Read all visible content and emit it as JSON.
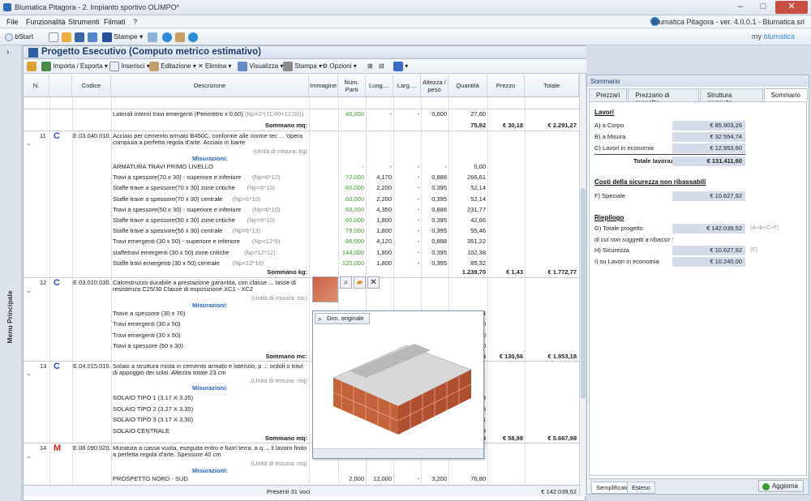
{
  "window": {
    "title": "Blumatica Pitagora - 2. Impianto sportivo OLIMPO*"
  },
  "menu": {
    "items": [
      "File",
      "Funzionalità",
      "Strumenti",
      "Filmati",
      "?"
    ],
    "version": "Blumatica Pitagora - ver. 4.0.0.1 - Blumatica srl"
  },
  "toolbar": {
    "bstart": "bStart",
    "stampe": "Stampe",
    "my": "my",
    "brand": "blumatica"
  },
  "sidebar": {
    "label": "Menu Principale"
  },
  "project": {
    "title": "Progetto Esecutivo (Computo metrico estimativo)"
  },
  "toolbar2": {
    "items": [
      "Importa / Esporta",
      "Inserisci",
      "Editazione",
      "Elimina",
      "Visualizza",
      "Stampa",
      "Opzioni"
    ]
  },
  "columns": [
    "N.",
    "Codice",
    "Descrizione",
    "Immagine",
    "Num. Parti",
    "Lung....",
    "Larg....",
    "Altezza / peso",
    "Quantità",
    "Prezzo",
    "Totale"
  ],
  "rows": {
    "r0": {
      "desc": "Laterali interni travi emergenti (Perimetro x 0,60)",
      "formula": "(Np=2*(11,00+12,00))",
      "parti": "46,000",
      "lung": "-",
      "larg": "-",
      "alt": "0,600",
      "qty": "27,60"
    },
    "s0": {
      "label": "Sommano mq:",
      "qty": "75,92",
      "price": "€ 30,18",
      "total": "€ 2.291,27"
    },
    "i11": {
      "n": "11",
      "type": "C",
      "code": "E.03.040.010.a",
      "desc1": "Acciaio per cemento armato B450C, conforme alle norme tec ... 'opera",
      "desc2": "compiuta a perfetta regola d'arte. Acciaio in barre",
      "unit": "(Unità di misura: kg)",
      "mis": "Misurazioni:"
    },
    "m11": [
      {
        "d": "ARMATURA TRAVI PRIMO LIVELLO",
        "f": "",
        "p": "-",
        "l": "-",
        "w": "-",
        "a": "-",
        "q": "0,00"
      },
      {
        "d": "Travi a spessore(70 x 30) - superiore e inferiore",
        "f": "(Np=6*12)",
        "p": "72,000",
        "l": "4,170",
        "w": "-",
        "a": "0,888",
        "q": "266,61"
      },
      {
        "d": "Staffe trave a spessore(70 x 30) zone critiche",
        "f": "(Np=6*10)",
        "p": "60,000",
        "l": "2,200",
        "w": "-",
        "a": "0,395",
        "q": "52,14"
      },
      {
        "d": "Staffe trave a spessore(70 x 30) centrale",
        "f": "(Np=6*10)",
        "p": "60,000",
        "l": "2,200",
        "w": "-",
        "a": "0,395",
        "q": "52,14"
      },
      {
        "d": "Travi a spessore(50 x 30) - superiore e inferiore",
        "f": "(Np=6*10)",
        "p": "60,000",
        "l": "4,350",
        "w": "-",
        "a": "0,888",
        "q": "231,77"
      },
      {
        "d": "Staffe trave a spessore(50 x 30) zone critiche",
        "f": "(Np=6*10)",
        "p": "60,000",
        "l": "1,800",
        "w": "-",
        "a": "0,395",
        "q": "42,66"
      },
      {
        "d": "Staffe trave a spessore(50 x 30) centrale",
        "f": "(Np=6*13)",
        "p": "78,000",
        "l": "1,800",
        "w": "-",
        "a": "0,395",
        "q": "55,46"
      },
      {
        "d": "Travi emergenti (30 x 50) - superiore e inferiore",
        "f": "(Np=12*8)",
        "p": "96,000",
        "l": "4,120",
        "w": "-",
        "a": "0,888",
        "q": "351,22"
      },
      {
        "d": "staffetravi emergenti (30 x 50) zone critiche",
        "f": "(Np=12*12)",
        "p": "144,000",
        "l": "1,800",
        "w": "-",
        "a": "0,395",
        "q": "102,38"
      },
      {
        "d": "Staffe travi emergenti (30 x 50) centrale",
        "f": "(Np=12*10)",
        "p": "120,000",
        "l": "1,800",
        "w": "-",
        "a": "0,395",
        "q": "85,32"
      }
    ],
    "s11": {
      "label": "Sommano kg:",
      "qty": "1.239,70",
      "price": "€ 1,43",
      "total": "€ 1.772,77"
    },
    "i12": {
      "n": "12",
      "type": "C",
      "code": "E.03.010.030.a",
      "desc1": "Calcestruzzo durabile a prestazione garantita, con classe ... lasse di",
      "desc2": "resistenza C25/30 Classe di esposizione XC1 - XC2",
      "unit": "(Unità di misura: mc)",
      "mis": "Misurazioni:"
    },
    "m12": [
      {
        "d": "Trave a spessore  (30 x 70)",
        "q": "4"
      },
      {
        "d": "Travi emergenti (30 x 50)",
        "q": "0"
      },
      {
        "d": "Travi emergenti (30 x 50)",
        "q": "0"
      },
      {
        "d": "Travi a spessore (50 x 30)",
        "q": "0"
      }
    ],
    "s12": {
      "label": "Sommano mc:",
      "qty": "6",
      "price": "€ 130,56",
      "total": "€ 1.953,18"
    },
    "i13": {
      "n": "13",
      "type": "C",
      "code": "E.04.015.010.b",
      "desc1": "Solaio a struttura mista in cemento armato e laterizio, p ... ordoli o travi",
      "desc2": "di appoggio dei solai. Altezza totale 23 cm",
      "unit": "(Unità di misura: mq)",
      "mis": "Misurazioni:"
    },
    "m13": [
      {
        "d": "SOLAIO TIPO 1 (3.17 X 3.35)",
        "q": "8"
      },
      {
        "d": "SOLAIO TIPO 2 (3.27 X 3.35)",
        "q": "5"
      },
      {
        "d": "SOLAIO TIPO 3 (3.17 X 3,30)",
        "q": "1"
      },
      {
        "d": "SOLAIO CENTRALE",
        "q": "9"
      }
    ],
    "s13": {
      "label": "Sommano mq:",
      "qty": "0",
      "price": "€ 58,98",
      "total": "€ 5.667,98"
    },
    "i14": {
      "n": "14",
      "type": "M",
      "code": "E.08.090.020.a",
      "desc1": "Muratura a cassa vuota, eseguita entro e fuori terra, a q ... il lavoro finito",
      "desc2": "a perfetta regola d'arte. Spessore 40 cm",
      "unit": "(Unità di misura: mq)",
      "mis": "Misurazioni:"
    },
    "m14": {
      "d": "PROSPETTO NORD - SUD",
      "p": "2,000",
      "l": "12,000",
      "w": "-",
      "a": "3,200",
      "q": "76,80"
    }
  },
  "popup": {
    "button": "Dim. originale"
  },
  "footer": {
    "count": "Presenti 31 voci",
    "total": "€ 142.039,52"
  },
  "summary": {
    "title": "Sommario",
    "tabs": [
      "Prezzari",
      "Prezzario di progetto",
      "Struttura computo",
      "Sommario"
    ],
    "lavori": "Lavori",
    "a": {
      "label": "A) a Corpo",
      "value": "€ 85.903,26"
    },
    "b": {
      "label": "B) a Misura",
      "value": "€ 32.554,74"
    },
    "c": {
      "label": "C) Lavori in economia",
      "value": "€ 12.953,60"
    },
    "tot": {
      "label": "Totale lavorazioni",
      "value": "€ 131.411,60"
    },
    "costi": "Costi della sicurezza non ribassabili",
    "f": {
      "label": "F) Speciale",
      "value": "€ 10.627,92"
    },
    "riep": "Riepilogo",
    "g": {
      "label": "G) Totale progetto",
      "value": "€ 142.039,52",
      "note": "(A+B+C+F)"
    },
    "sub": "di cui non soggetti a ribasso :",
    "h": {
      "label": "H) Sicurezza",
      "value": "€ 10.627,92",
      "note": "(F)"
    },
    "i": {
      "label": "I) su Lavori in economia",
      "value": "€ 10.240,00"
    },
    "bottomtabs": [
      "Semplificato",
      "Esteso"
    ],
    "refresh": "Aggiorna"
  }
}
